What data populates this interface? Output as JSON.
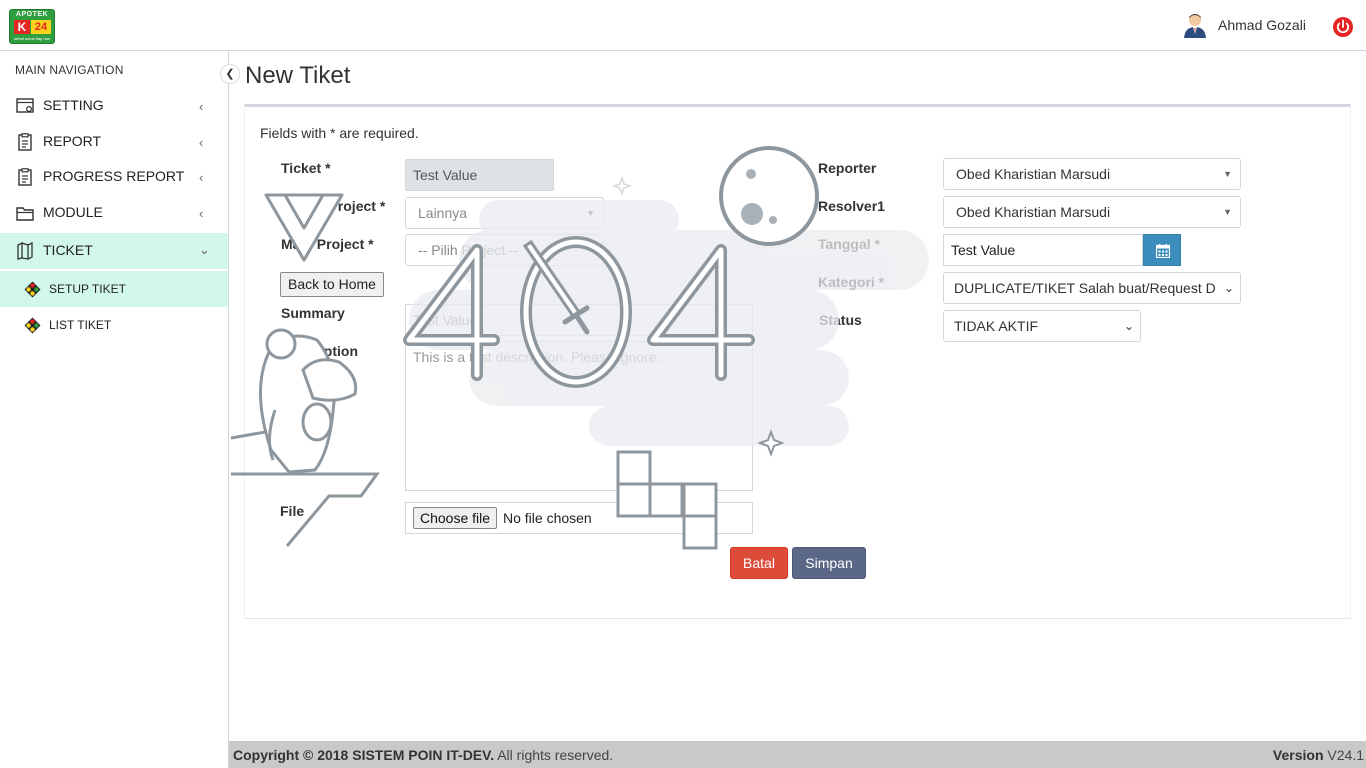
{
  "header": {
    "logo": {
      "top": "APOTEK",
      "k": "K",
      "num": "24",
      "tagline": "sehat sehat tiap hari"
    },
    "user_name": "Ahmad Gozali"
  },
  "sidebar": {
    "header": "MAIN NAVIGATION",
    "items": [
      {
        "label": "SETTING"
      },
      {
        "label": "REPORT"
      },
      {
        "label": "PROGRESS REPORT"
      },
      {
        "label": "MODULE"
      },
      {
        "label": "TICKET"
      }
    ],
    "sub_items": [
      {
        "label": "SETUP TIKET"
      },
      {
        "label": "LIST TIKET"
      }
    ]
  },
  "page": {
    "title": "New Tiket",
    "required_note": "Fields with * are required."
  },
  "form": {
    "ticket_label": "Ticket *",
    "ticket_value": "Test Value",
    "parent_project_label": "Parent Project *",
    "parent_project_value": "Lainnya",
    "main_project_label": "Main Project *",
    "main_project_value": "-- Pilih Project --",
    "back_home": "Back to Home",
    "summary_label": "Summary",
    "summary_value": "Test Value",
    "description_label": "Description",
    "description_value": "This is a test description. Please ignore.",
    "file_label": "File",
    "file_button": "Choose file",
    "file_status": "No file chosen",
    "reporter_label": "Reporter",
    "reporter_value": "Obed Kharistian Marsudi",
    "resolver_label": "Resolver1",
    "resolver_value": "Obed Kharistian Marsudi",
    "tanggal_label": "Tanggal *",
    "tanggal_value": "Test Value",
    "kategori_label": "Kategori *",
    "kategori_value": "DUPLICATE/TIKET Salah buat/Request D",
    "status_label": "Status",
    "status_value": "TIDAK AKTIF",
    "cancel_label": "Batal",
    "save_label": "Simpan"
  },
  "overlay": {
    "text": "404"
  },
  "footer": {
    "copyright_prefix": "Copyright © 2018",
    "company": "SISTEM POIN IT-DEV.",
    "rights": "All rights reserved.",
    "version_label": "Version",
    "version_value": "V24.1"
  },
  "colors": {
    "active_nav": "#d2f8ee",
    "primary": "#3c8dbc",
    "danger": "#dd4b39",
    "save": "#5a6786",
    "footer": "#c8cac9"
  }
}
